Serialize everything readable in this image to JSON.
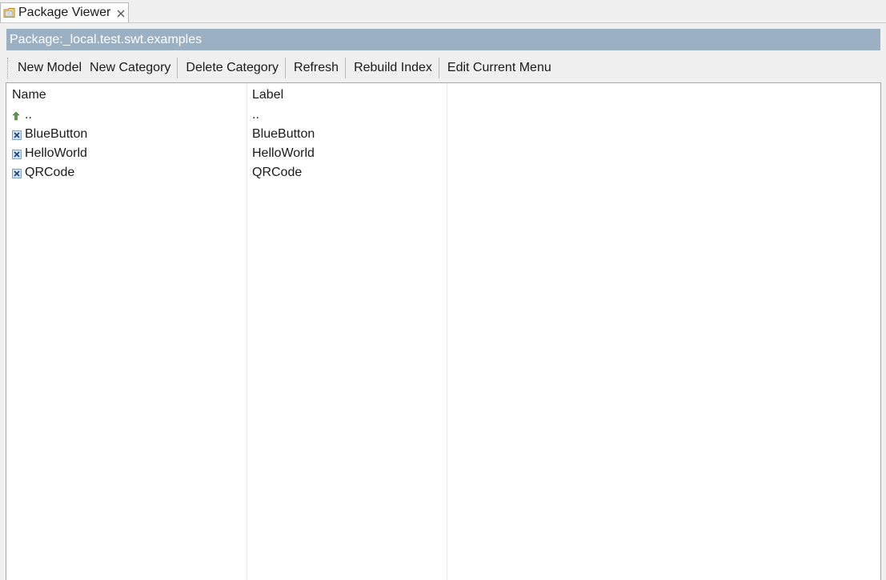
{
  "tab": {
    "title": "Package Viewer",
    "icon": "package-folder-icon",
    "close_icon": "close-icon"
  },
  "package_bar": {
    "text": "Package:_local.test.swt.examples"
  },
  "toolbar": {
    "new_model": "New Model",
    "new_category": "New Category",
    "delete_category": "Delete Category",
    "refresh": "Refresh",
    "rebuild_index": "Rebuild Index",
    "edit_current_menu": "Edit Current Menu"
  },
  "table": {
    "columns": [
      "Name",
      "Label"
    ],
    "rows": [
      {
        "icon": "parent-up-arrow-icon",
        "name": "..",
        "label": ".."
      },
      {
        "icon": "model-icon",
        "name": "BlueButton",
        "label": "BlueButton"
      },
      {
        "icon": "model-icon",
        "name": "HelloWorld",
        "label": "HelloWorld"
      },
      {
        "icon": "model-icon",
        "name": "QRCode",
        "label": "QRCode"
      }
    ]
  },
  "colors": {
    "package_bar_bg": "#9bb0c2",
    "up_arrow": "#5c9a4a",
    "model_icon_bg": "#cfe3f5",
    "model_icon_x": "#1f3f7a"
  }
}
